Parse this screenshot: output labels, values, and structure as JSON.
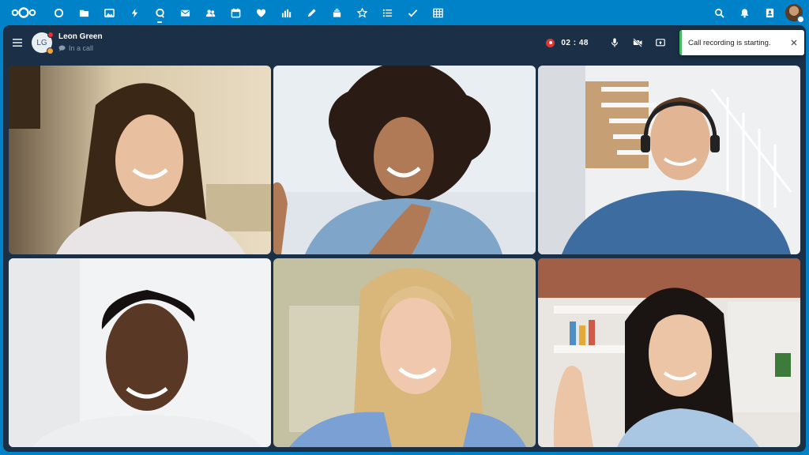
{
  "topbar": {
    "logo_icon": "nextcloud-logo-icon",
    "apps": [
      {
        "icon": "dashboard-icon",
        "active": false
      },
      {
        "icon": "files-icon",
        "active": false
      },
      {
        "icon": "photos-icon",
        "active": false
      },
      {
        "icon": "activity-icon",
        "active": false
      },
      {
        "icon": "talk-icon",
        "active": true
      },
      {
        "icon": "mail-icon",
        "active": false
      },
      {
        "icon": "contacts-icon",
        "active": false
      },
      {
        "icon": "calendar-icon",
        "active": false
      },
      {
        "icon": "heart-icon",
        "active": false
      },
      {
        "icon": "analytics-icon",
        "active": false
      },
      {
        "icon": "edit-icon",
        "active": false
      },
      {
        "icon": "deck-icon",
        "active": false
      },
      {
        "icon": "starred-icon",
        "active": false
      },
      {
        "icon": "list-icon",
        "active": false
      },
      {
        "icon": "tasks-icon",
        "active": false
      },
      {
        "icon": "tables-icon",
        "active": false
      }
    ],
    "right_icons": [
      "search-icon",
      "notifications-icon",
      "contacts-menu-icon"
    ]
  },
  "call": {
    "conversation": {
      "avatar_initials": "LG",
      "name": "Leon Green",
      "status": "In a call"
    },
    "recording": {
      "timer": "02 : 48"
    },
    "toast": {
      "message": "Call recording is starting."
    }
  },
  "colors": {
    "brand": "#0082c9",
    "call_background": "#1b3047",
    "recording": "#e9322d",
    "toast_accent": "#46ba61"
  }
}
